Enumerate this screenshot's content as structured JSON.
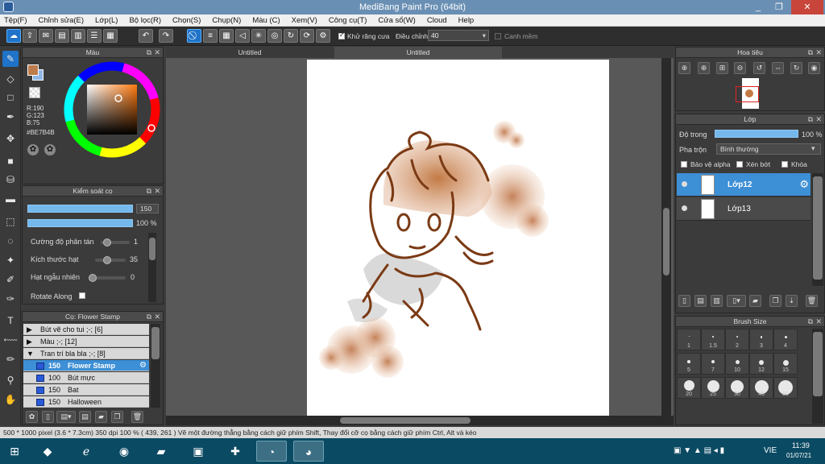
{
  "window": {
    "title": "MediBang Paint Pro (64bit)",
    "minimize": "_",
    "restore": "❐",
    "close": "✕"
  },
  "menu": [
    "Tệp(F)",
    "Chỉnh sửa(E)",
    "Lớp(L)",
    "Bộ lọc(R)",
    "Chọn(S)",
    "Chụp(N)",
    "Màu (C)",
    "Xem(V)",
    "Công cụ(T)",
    "Cửa sổ(W)",
    "Cloud",
    "Help"
  ],
  "toolbar": {
    "antialias_label": "Khử răng cưa",
    "correction_label": "Điều chỉnh",
    "correction_value": "40",
    "snap_label": "Canh mềm"
  },
  "color_panel": {
    "title": "Màu",
    "r": "R:190",
    "g": "G:123",
    "b": "B:75",
    "hex": "#BE7B4B",
    "primary_color": "#BE7B4B",
    "secondary_color": "#8FB6E8"
  },
  "brush_control": {
    "title": "Kiểm soát cọ",
    "size_value": "150",
    "opacity_value": "100 %",
    "size_fraction": 1.0,
    "opacity_fraction": 1.0,
    "params": [
      {
        "label": "Cường độ phân tán",
        "value": "1",
        "fraction": 0.1
      },
      {
        "label": "Kích thước hạt",
        "value": "35",
        "fraction": 0.35
      },
      {
        "label": "Hạt ngẫu nhiên",
        "value": "0",
        "fraction": 0.0
      }
    ],
    "rotate_label": "Rotate Along"
  },
  "brush_panel": {
    "title": "Cọ: Flower Stamp",
    "groups": [
      {
        "arrow": "▶",
        "label": "Bút vẽ cho tui ;-; [6]"
      },
      {
        "arrow": "▶",
        "label": "Màu ;-; [12]"
      },
      {
        "arrow": "▼",
        "label": "Tran trí bla bla ;-; [8]"
      }
    ],
    "items": [
      {
        "size": "150",
        "name": "Flower Stamp",
        "selected": true
      },
      {
        "size": "100",
        "name": "Bút mực",
        "selected": false
      },
      {
        "size": "150",
        "name": "Bat",
        "selected": false
      },
      {
        "size": "150",
        "name": "Halloween",
        "selected": false
      }
    ]
  },
  "tabs": [
    {
      "label": "Untitled"
    },
    {
      "label": "Untitled"
    }
  ],
  "navigator": {
    "title": "Hoa tiêu"
  },
  "layer_panel": {
    "title": "Lớp",
    "opacity_label": "Độ trong",
    "opacity_value": "100 %",
    "opacity_fraction": 1.0,
    "blend_label": "Pha trộn",
    "blend_value": "Bình thường",
    "protect_alpha": "Bảo vệ alpha",
    "clipping": "Xén bớt",
    "lock": "Khóa",
    "layers": [
      {
        "name": "Lớp12",
        "selected": true
      },
      {
        "name": "Lớp13",
        "selected": false
      }
    ]
  },
  "brush_size_panel": {
    "title": "Brush Size",
    "sizes": [
      "1",
      "1.5",
      "2",
      "3",
      "4",
      "5",
      "7",
      "10",
      "12",
      "15",
      "20",
      "25",
      "30",
      "40",
      "50"
    ]
  },
  "status": "500 * 1000 pixel   (3.6 * 7.3cm)   350 dpi   100 %   ( 439, 261 )   Vẽ một đường thẳng bằng cách giữ phím Shift, Thay đổi cỡ cọ bằng cách giữ phím Ctrl, Alt và kéo",
  "taskbar": {
    "language": "VIE",
    "time": "11:39",
    "date": "01/07/21"
  }
}
